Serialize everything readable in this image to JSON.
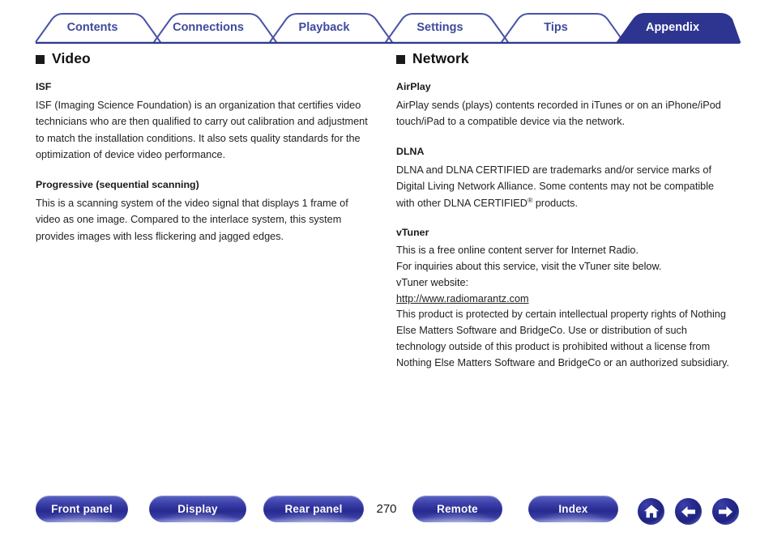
{
  "tabs": [
    {
      "label": "Contents",
      "active": false
    },
    {
      "label": "Connections",
      "active": false
    },
    {
      "label": "Playback",
      "active": false
    },
    {
      "label": "Settings",
      "active": false
    },
    {
      "label": "Tips",
      "active": false
    },
    {
      "label": "Appendix",
      "active": true
    }
  ],
  "colors": {
    "tab_text": "#3f4a9e",
    "tab_active_fill": "#2e3590",
    "tab_outline": "#4a53a8",
    "button_blue": "#272a8e",
    "text": "#1a1a1a"
  },
  "left_column": {
    "heading": "Video",
    "entries": [
      {
        "term": "ISF",
        "body": "ISF (Imaging Science Foundation) is an organization that certifies video technicians who are then qualified to carry out calibration and adjustment to match the installation conditions. It also sets quality standards for the optimization of device video performance."
      },
      {
        "term": "Progressive (sequential scanning)",
        "body": "This is a scanning system of the video signal that displays 1 frame of video as one image. Compared to the interlace system, this system provides images with less flickering and jagged edges."
      }
    ]
  },
  "right_column": {
    "heading": "Network",
    "airplay": {
      "term": "AirPlay",
      "body": "AirPlay sends (plays) contents recorded in iTunes or on an iPhone/iPod touch/iPad to a compatible device via the network."
    },
    "dlna": {
      "term": "DLNA",
      "body_part1": "DLNA and DLNA CERTIFIED are trademarks and/or service marks of Digital Living Network Alliance. Some contents may not be compatible with other DLNA CERTIFIED",
      "superscript": "®",
      "body_part2": " products."
    },
    "vtuner": {
      "term": "vTuner",
      "line1": "This is a free online content server for Internet Radio.",
      "line2": "For inquiries about this service, visit the vTuner site below.",
      "line3": "vTuner website:",
      "url": "http://www.radiomarantz.com",
      "notice": "This product is protected by certain intellectual property rights of Nothing Else Matters Software and BridgeCo. Use or distribution of such technology outside of this product is prohibited without a license from Nothing Else Matters Software and BridgeCo or an authorized subsidiary."
    }
  },
  "footer": {
    "buttons": [
      {
        "label": "Front panel"
      },
      {
        "label": "Display"
      },
      {
        "label": "Rear panel"
      },
      {
        "label": "Remote"
      },
      {
        "label": "Index"
      }
    ],
    "page_number": "270",
    "nav_icons": [
      {
        "name": "home-icon"
      },
      {
        "name": "arrow-left-icon"
      },
      {
        "name": "arrow-right-icon"
      }
    ]
  }
}
